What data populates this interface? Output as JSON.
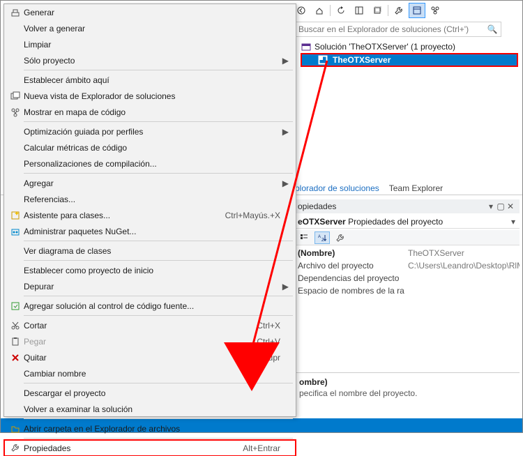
{
  "toolbar_icons": [
    "back",
    "home",
    "sep",
    "refresh",
    "collapse",
    "showall",
    "sep",
    "wrench",
    "propwin",
    "graph"
  ],
  "search": {
    "placeholder": "Buscar en el Explorador de soluciones (Ctrl+')"
  },
  "solution_line": "Solución 'TheOTXServer' (1 proyecto)",
  "project_name": "TheOTXServer",
  "tabs": {
    "active": "plorador de soluciones",
    "other": "Team Explorer"
  },
  "props_panel": {
    "title": "opiedades",
    "combo_object": "eOTXServer",
    "combo_suffix": "Propiedades del proyecto",
    "rows": [
      {
        "k": "(Nombre)",
        "v": "TheOTXServer",
        "bold": true
      },
      {
        "k": "Archivo del proyecto",
        "v": "C:\\Users\\Leandro\\Desktop\\RlMa"
      },
      {
        "k": "Dependencias del proyecto",
        "v": ""
      },
      {
        "k": "Espacio de nombres de la ra",
        "v": ""
      }
    ],
    "desc_title": "ombre)",
    "desc_text": "pecifica el nombre del proyecto."
  },
  "menu": {
    "groups": [
      [
        {
          "icon": "build",
          "label": "Generar",
          "sc": ""
        },
        {
          "icon": "",
          "label": "Volver a generar",
          "sc": ""
        },
        {
          "icon": "",
          "label": "Limpiar",
          "sc": ""
        },
        {
          "icon": "",
          "label": "Sólo proyecto",
          "sc": "",
          "sub": true
        }
      ],
      [
        {
          "icon": "",
          "label": "Establecer ámbito aquí",
          "sc": ""
        },
        {
          "icon": "newview",
          "label": "Nueva vista de Explorador de soluciones",
          "sc": ""
        },
        {
          "icon": "map",
          "label": "Mostrar en mapa de código",
          "sc": ""
        }
      ],
      [
        {
          "icon": "",
          "label": "Optimización guiada por perfiles",
          "sc": "",
          "sub": true
        },
        {
          "icon": "",
          "label": "Calcular métricas de código",
          "sc": ""
        },
        {
          "icon": "",
          "label": "Personalizaciones de compilación...",
          "sc": ""
        }
      ],
      [
        {
          "icon": "",
          "label": "Agregar",
          "sc": "",
          "sub": true
        },
        {
          "icon": "",
          "label": "Referencias...",
          "sc": ""
        },
        {
          "icon": "classwiz",
          "label": "Asistente para clases...",
          "sc": "Ctrl+Mayús.+X"
        },
        {
          "icon": "nuget",
          "label": "Administrar paquetes NuGet...",
          "sc": ""
        }
      ],
      [
        {
          "icon": "",
          "label": "Ver diagrama de clases",
          "sc": ""
        }
      ],
      [
        {
          "icon": "",
          "label": "Establecer como proyecto de inicio",
          "sc": ""
        },
        {
          "icon": "",
          "label": "Depurar",
          "sc": "",
          "sub": true
        }
      ],
      [
        {
          "icon": "scc",
          "label": "Agregar solución al control de código fuente...",
          "sc": ""
        }
      ],
      [
        {
          "icon": "cut",
          "label": "Cortar",
          "sc": "Ctrl+X"
        },
        {
          "icon": "paste",
          "label": "Pegar",
          "sc": "Ctrl+V",
          "disabled": true
        },
        {
          "icon": "delete",
          "label": "Quitar",
          "sc": "Supr"
        },
        {
          "icon": "",
          "label": "Cambiar nombre",
          "sc": ""
        }
      ],
      [
        {
          "icon": "",
          "label": "Descargar el proyecto",
          "sc": ""
        },
        {
          "icon": "",
          "label": "Volver a examinar la solución",
          "sc": ""
        }
      ],
      [
        {
          "icon": "folder",
          "label": "Abrir carpeta en el Explorador de archivos",
          "sc": ""
        }
      ],
      [
        {
          "icon": "wrench",
          "label": "Propiedades",
          "sc": "Alt+Entrar",
          "outlined": true
        }
      ]
    ]
  }
}
